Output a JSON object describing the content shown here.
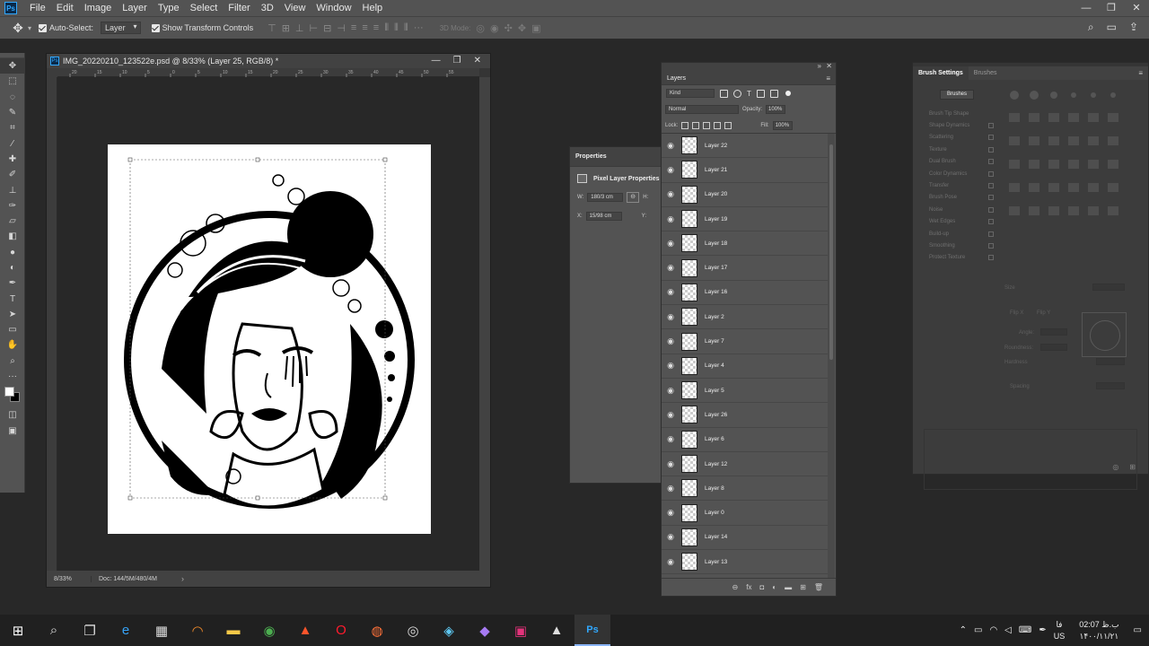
{
  "menubar": {
    "logo": "Ps",
    "items": [
      "File",
      "Edit",
      "Image",
      "Layer",
      "Type",
      "Select",
      "Filter",
      "3D",
      "View",
      "Window",
      "Help"
    ],
    "controls": [
      "—",
      "❐",
      "✕"
    ]
  },
  "options": {
    "auto_select_label": "Auto-Select:",
    "auto_select_value": "Layer",
    "transform_label": "Show Transform Controls",
    "mode_3d_label": "3D Mode:"
  },
  "tools": {
    "foreground_color": "#ffffff",
    "background_color": "#000000",
    "icons": [
      "move-icon",
      "marquee-icon",
      "lasso-icon",
      "quick-select-icon",
      "crop-icon",
      "eyedropper-icon",
      "healing-icon",
      "brush-icon",
      "stamp-icon",
      "history-brush-icon",
      "eraser-icon",
      "gradient-icon",
      "blur-icon",
      "dodge-icon",
      "pen-icon",
      "type-icon",
      "path-select-icon",
      "shape-icon",
      "hand-icon",
      "zoom-icon",
      "more-icon"
    ]
  },
  "document": {
    "title": "IMG_20220210_123522e.psd @ 8/33% (Layer 25, RGB/8) *",
    "zoom": "8/33%",
    "doc_info": "Doc: 144/5M/480/4M",
    "status_arrow": "›",
    "controls": [
      "—",
      "❐",
      "✕"
    ],
    "ruler_ticks": [
      "20",
      "15",
      "10",
      "5",
      "0",
      "5",
      "10",
      "15",
      "20",
      "25",
      "30",
      "35",
      "40",
      "45",
      "50",
      "55"
    ]
  },
  "properties": {
    "title": "Properties",
    "subtitle": "Pixel Layer Properties",
    "w_label": "W:",
    "w_value": "180/3 cm",
    "h_label": "H:",
    "x_label": "X:",
    "x_value": "15/98 cm",
    "y_label": "Y:",
    "link_icon": "⊖"
  },
  "layers": {
    "title": "Layers",
    "kind_label": "Kind",
    "blend_mode": "Normal",
    "opacity_label": "Opacity:",
    "opacity_value": "100%",
    "lock_label": "Lock:",
    "fill_label": "Fill:",
    "fill_value": "100%",
    "items": [
      {
        "name": "Layer 22"
      },
      {
        "name": "Layer 21"
      },
      {
        "name": "Layer 20"
      },
      {
        "name": "Layer 19"
      },
      {
        "name": "Layer 18"
      },
      {
        "name": "Layer 17"
      },
      {
        "name": "Layer 16"
      },
      {
        "name": "Layer 2"
      },
      {
        "name": "Layer 7"
      },
      {
        "name": "Layer 4"
      },
      {
        "name": "Layer 5"
      },
      {
        "name": "Layer 26"
      },
      {
        "name": "Layer 6"
      },
      {
        "name": "Layer 12"
      },
      {
        "name": "Layer 8"
      },
      {
        "name": "Layer 0"
      },
      {
        "name": "Layer 14"
      },
      {
        "name": "Layer 13"
      }
    ],
    "footer_icons": [
      "link-icon",
      "fx-icon",
      "mask-icon",
      "adjustment-icon",
      "group-icon",
      "new-layer-icon",
      "trash-icon"
    ]
  },
  "brush_settings": {
    "tab_active": "Brush Settings",
    "tab_other": "Brushes",
    "presets_button": "Brushes",
    "options": [
      "Brush Tip Shape",
      "Shape Dynamics",
      "Scattering",
      "Texture",
      "Dual Brush",
      "Color Dynamics",
      "Transfer",
      "Brush Pose",
      "Noise",
      "Wet Edges",
      "Build-up",
      "Smoothing",
      "Protect Texture"
    ],
    "size_label": "Size",
    "flip_x": "Flip X",
    "flip_y": "Flip Y",
    "angle_label": "Angle:",
    "roundness_label": "Roundness:",
    "hardness_label": "Hardness",
    "spacing_label": "Spacing",
    "grid_sizes": [
      "",
      "",
      "",
      "",
      "",
      "",
      "",
      "",
      "",
      "",
      "",
      "",
      "",
      "",
      "",
      "",
      "",
      "",
      "",
      "",
      "",
      "",
      "",
      "",
      "",
      "",
      "",
      "",
      "",
      "",
      "",
      "",
      "",
      "",
      "",
      "",
      "",
      "",
      "",
      "",
      "",
      "",
      "",
      "",
      "",
      "",
      "",
      ""
    ]
  },
  "taskbar": {
    "apps": [
      "windows-start-icon",
      "search-icon",
      "task-view-icon",
      "edge-icon",
      "calculator-icon",
      "app-icon",
      "file-explorer-icon",
      "chrome-icon",
      "brave-icon",
      "opera-icon",
      "firefox-icon",
      "app-icon",
      "app-icon",
      "visual-studio-icon",
      "app-icon",
      "photos-icon",
      "photoshop-icon"
    ],
    "time": "02:07 ب.ظ",
    "date": "۱۴۰۰/۱۱/۲۱",
    "lang_top": "فا",
    "lang_bottom": "US"
  }
}
